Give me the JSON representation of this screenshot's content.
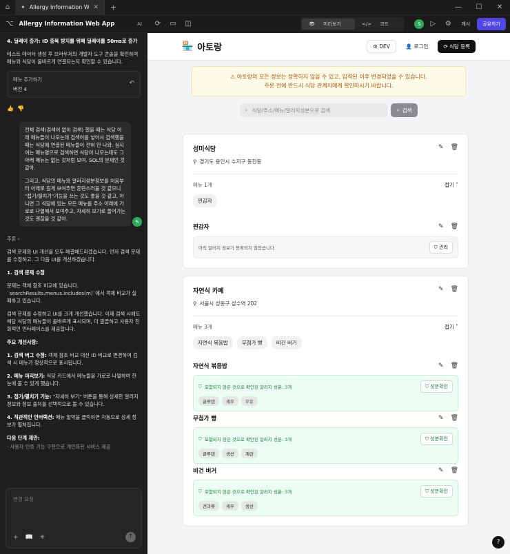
{
  "window": {
    "tab_title": "Allergy Information Web App",
    "app_title": "Allergy Information Web App",
    "ai_label": "AI",
    "view_preview": "미리보기",
    "view_code": "코드",
    "user_initial": "S",
    "publish": "게시",
    "share": "공유하기"
  },
  "chat": {
    "m0": "4. 딜레이 증가: ID 중복 방지를 위해 딜레이를 50ms로 증가",
    "m1": "테스트 데이터 생성 후 브라우저의 개발자 도구 콘솔을 확인하여 메뉴와 식당이 올바르게 연결되는지 확인할 수 있습니다.",
    "version_label": "메뉴 추가하기",
    "version_num": "버전 4",
    "user_msg_1": "전체 검색(검색어 없이 검색) 했을 때는 식당 아래 메뉴들이 나오는데 검색어를 넣어서 검색했을 때는 식당에 연결된 메뉴들이 전혀 안 나와. 심지어는 메뉴명으로 검색하면 식당이 나오는데도 그 아래 메뉴는 없는 것처럼 보여. SQL의 문제인 것 같아.",
    "user_msg_2": "그리고, 식당의 메뉴와 알러지성분정보를 처음부터 아래로 길게 보여주면 혼란스러울 것 같으니 \"접기/펼치기\"기능을 쓰는 것도 좋을 것 같고, 아니면 그 식당에 있는 모든 메뉴를 주소 아래에 가로로 나열해서 보여주고, 자세히 보기로 들어가는 것도 괜찮을 것 같아.",
    "reason": "추론",
    "r1": "검색 문제와 UI 개선을 모두 해결해드리겠습니다. 먼저 검색 문제를 수정하고, 그 다음 UI를 개선하겠습니다.",
    "h1": "1. 검색 문제 수정",
    "r2": "문제는 객체 참조 비교에 있습니다. `searchResults.menus.includes(m)`에서 객체 비교가 실패하고 있습니다.",
    "r3": "검색 문제를 수정하고 UI를 크게 개선했습니다. 이제 검색 시에도 해당 식당의 메뉴들이 올바르게 표시되며, 더 깔끔하고 사용자 친화적인 인터페이스를 제공합니다.",
    "h2": "주요 개선사항:",
    "i1b": "1. 검색 버그 수정:",
    "i1": " 객체 참조 비교 대신 ID 비교로 변경하여 검색 시 메뉴가 정상적으로 표시됩니다.",
    "i2b": "2. 메뉴 미리보기:",
    "i2": " 식당 카드에서 메뉴들을 가로로 나열하여 한눈에 볼 수 있게 했습니다.",
    "i3b": "3. 접기/펼치기 기능:",
    "i3": " \"자세히 보기\" 버튼을 통해 상세한 알러지 정보와 정보 출처를 선택적으로 볼 수 있습니다.",
    "i4b": "4. 직관적인 인터랙션:",
    "i4": " 메뉴 알약을 클릭하면 자동으로 상세 정보가 펼쳐집니다.",
    "h3": "다음 단계 제안:",
    "n1": "· 사용자 인증 기능 구현으로 개인화된 서비스 제공",
    "input_placeholder": "변경 요청"
  },
  "app": {
    "logo": "아토랑",
    "dev": "DEV",
    "login": "로그인",
    "register": "식당 등록",
    "warn1": "아토랑의 모든 정보는 정확하지 않을 수 있고, 입력된 이후 변경되었을 수 있습니다.",
    "warn2": "주문 전에 반드시 식당 관계자에게 확인하시기 바랍니다.",
    "search_placeholder": "식당/주소/메뉴/알러지성분으로 검색",
    "search_btn": "검색",
    "fold": "접기",
    "r1": {
      "name": "성미식당",
      "addr": "경기도 용인시 수지구 동천동",
      "menu_count": "메뉴 1개",
      "chips": [
        "찐감자"
      ],
      "menu1": "찐감자",
      "no_info": "아직 알러지 정보가 등록되지 않았습니다.",
      "manage": "관리"
    },
    "r2": {
      "name": "자연식 카페",
      "addr": "서울시 성동구 성수역 202",
      "menu_count": "메뉴 3개",
      "chips": [
        "자연식 볶음밥",
        "무첨가 빵",
        "비건 버거"
      ],
      "check_text": "포함되지 않은 것으로 확인된 알러지 성분: 3개",
      "check_btn": "성분확인",
      "menus": [
        {
          "name": "자연식 볶음밥",
          "allergens": [
            "글루텐",
            "새우",
            "우유"
          ]
        },
        {
          "name": "무첨가 빵",
          "allergens": [
            "글루텐",
            "생선",
            "계란"
          ]
        },
        {
          "name": "비건 버거",
          "allergens": [
            "견과류",
            "새우",
            "생선"
          ]
        }
      ]
    }
  }
}
